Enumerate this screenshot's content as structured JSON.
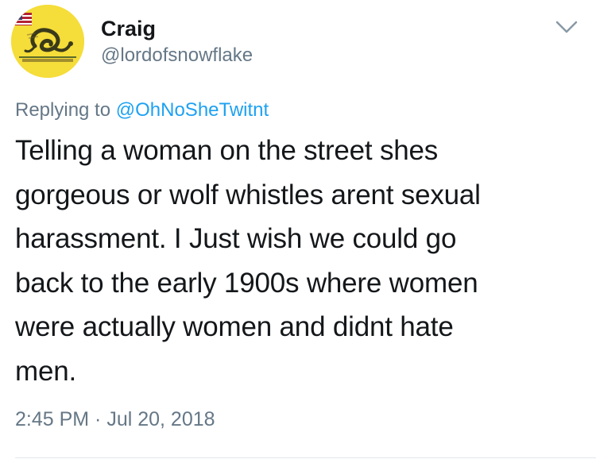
{
  "author": {
    "display_name": "Craig",
    "handle": "@lordofsnowflake",
    "avatar_icon": "dont-tread-on-me-flag-avatar"
  },
  "menu": {
    "icon": "chevron-down-icon"
  },
  "reply": {
    "prefix": "Replying to",
    "mention": "@OhNoSheTwitnt"
  },
  "tweet": {
    "lines": [
      "Telling a woman on the street shes",
      "gorgeous or wolf whistles arent sexual",
      "harassment. I Just wish we could go",
      "back to the early 1900s where women",
      "were actually women and didnt hate",
      "men."
    ]
  },
  "timestamp": "2:45 PM · Jul 20, 2018",
  "colors": {
    "text": "#14171a",
    "muted": "#657786",
    "link": "#1da1f2",
    "divider": "#e1e8ed",
    "avatar_yellow": "#f5dd3a"
  }
}
